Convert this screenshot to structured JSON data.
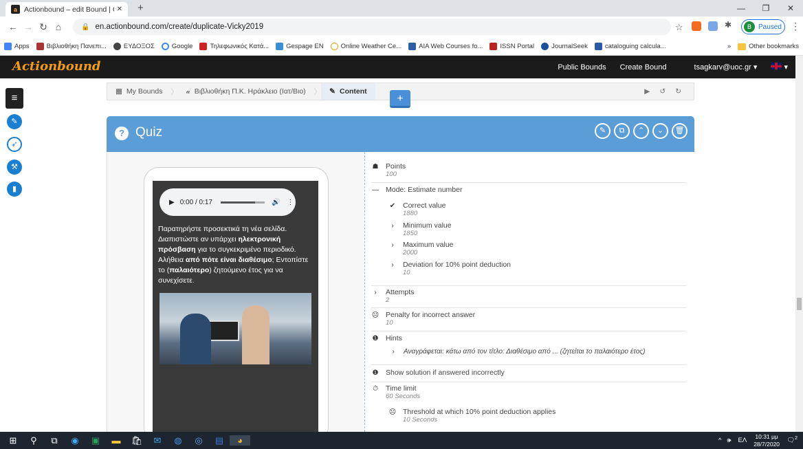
{
  "browser": {
    "tab_title": "Actionbound – edit Bound | Crea",
    "url": "en.actionbound.com/create/duplicate-Vicky2019",
    "profile_label": "Paused",
    "profile_initial": "B",
    "bookmarks": [
      "Apps",
      "Βιβλιοθήκη Πανεπι...",
      "ΕΥΔΟΞΟΣ",
      "Google",
      "Τηλεφωνικός Κατά...",
      "Gespage EN",
      "Online Weather Ce...",
      "AIA Web Courses fo...",
      "ISSN Portal",
      "JournalSeek",
      "cataloguing calcula..."
    ],
    "other_bookmarks": "Other bookmarks"
  },
  "app": {
    "logo": "Actionbound",
    "nav": [
      "Public Bounds",
      "Create Bound",
      "tsagkarv@uoc.gr"
    ]
  },
  "breadcrumb": {
    "my_bounds": "My Bounds",
    "bound": "Βιβλιοθήκη Π.Κ. Ηράκλειο (Ιατ/Βιο)",
    "content": "Content"
  },
  "quiz": {
    "title": "Quiz",
    "audio_time": "0:00 / 0:17",
    "question_parts": [
      {
        "t": "Παρατηρήστε προσεκτικά τη νέα σελίδα. Διαπιστώστε αν υπάρχει ",
        "b": false
      },
      {
        "t": "ηλεκτρονική πρόσβαση",
        "b": true
      },
      {
        "t": " για το συγκεκριμένο περιοδικό. Αλήθεια ",
        "b": false
      },
      {
        "t": "από πότε είναι διαθέσιμο",
        "b": true
      },
      {
        "t": "; Εντοπίστε το (",
        "b": false
      },
      {
        "t": "παλαιότερο",
        "b": true
      },
      {
        "t": ") ζητούμενο έτος για να συνεχίσετε.",
        "b": false
      }
    ]
  },
  "settings": {
    "points": {
      "label": "Points",
      "value": "100"
    },
    "mode": {
      "label": "Mode: Estimate number"
    },
    "correct": {
      "label": "Correct value",
      "value": "1880"
    },
    "minimum": {
      "label": "Minimum value",
      "value": "1850"
    },
    "maximum": {
      "label": "Maximum value",
      "value": "2000"
    },
    "deviation": {
      "label": "Deviation for 10% point deduction",
      "value": "10"
    },
    "attempts": {
      "label": "Attempts",
      "value": "2"
    },
    "penalty": {
      "label": "Penalty for incorrect answer",
      "value": "10"
    },
    "hints": {
      "label": "Hints",
      "value": "Αναγράφεται: κάτω από τον τίτλο: Διαθέσιμο από ... (ζητείται το παλαιότερο έτος)"
    },
    "show_solution": {
      "label": "Show solution if answered incorrectly"
    },
    "time_limit": {
      "label": "Time limit",
      "value": "60 Seconds"
    },
    "threshold": {
      "label": "Threshold at which 10% point deduction applies",
      "value": "10 Seconds"
    }
  },
  "taskbar": {
    "lang": "ΕΛ",
    "time": "10:31 μμ",
    "date": "28/7/2020",
    "notif": "2"
  }
}
